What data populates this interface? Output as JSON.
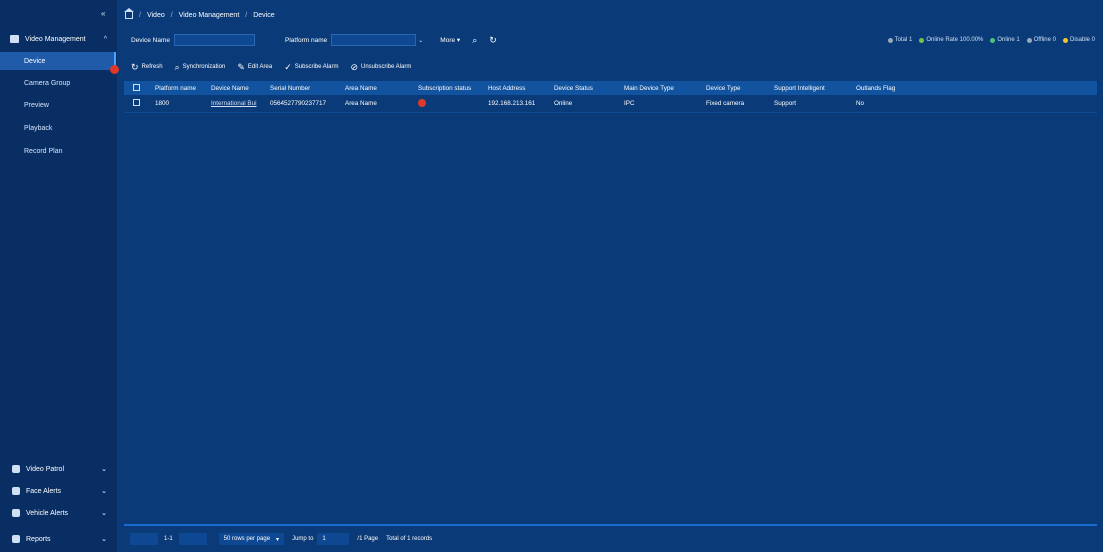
{
  "sidebar": {
    "collapse_label": "«",
    "group": {
      "label": "Video Management",
      "icon": "video-management-icon",
      "chevron": "^"
    },
    "items": [
      {
        "label": "Device",
        "active": true
      },
      {
        "label": "Camera Group"
      },
      {
        "label": "Preview"
      },
      {
        "label": "Playback"
      },
      {
        "label": "Record Plan"
      }
    ],
    "bottom": [
      {
        "label": "Video Patrol",
        "icon": "patrol-icon",
        "chevron": "⌄"
      },
      {
        "label": "Face Alerts",
        "icon": "face-icon",
        "chevron": "⌄"
      },
      {
        "label": "Vehicle Alerts",
        "icon": "vehicle-icon",
        "chevron": "⌄"
      },
      {
        "label": "Reports",
        "icon": "reports-icon",
        "chevron": "⌄"
      }
    ]
  },
  "breadcrumb": {
    "items": [
      "Video",
      "Video Management",
      "Device"
    ],
    "sep": "/"
  },
  "filters": {
    "device_name_label": "Device Name",
    "device_name_value": "",
    "platform_label": "Platform name",
    "platform_value": "",
    "more_label": "More ▾"
  },
  "stats": {
    "total": "Total 1",
    "online_rate": "Online Rate 100.00%",
    "online": "Online 1",
    "offline": "Offline 0",
    "disable": "Disable 0",
    "colors": {
      "total": "#9aa9bd",
      "online_rate": "#7cc242",
      "online": "#4cc37d",
      "offline": "#9aa9bd",
      "disable": "#f3c42f"
    }
  },
  "toolbar": {
    "refresh": "Refresh",
    "sync": "Synchronization",
    "edit_area": "Edit Area",
    "subscribe": "Subscribe Alarm",
    "unsubscribe": "Unsubscribe Alarm"
  },
  "table": {
    "headers": [
      "Platform name",
      "Device Name",
      "Serial Number",
      "Area Name",
      "Subscription status",
      "Host Address",
      "Device Status",
      "Main Device Type",
      "Device Type",
      "Support Intelligent",
      "Outlands Flag"
    ],
    "rows": [
      [
        "1800",
        "International Bui",
        "0564527790237717",
        "Area Name",
        "",
        "192.168.213.161",
        "Online",
        "IPC",
        "Fixed camera",
        "Support",
        "No"
      ]
    ]
  },
  "pager": {
    "range": "1-1",
    "per_page": "50 rows per page",
    "jump_label": "Jump to",
    "jump_value": "1",
    "page_label": "/1 Page",
    "total": "Total of 1 records"
  }
}
